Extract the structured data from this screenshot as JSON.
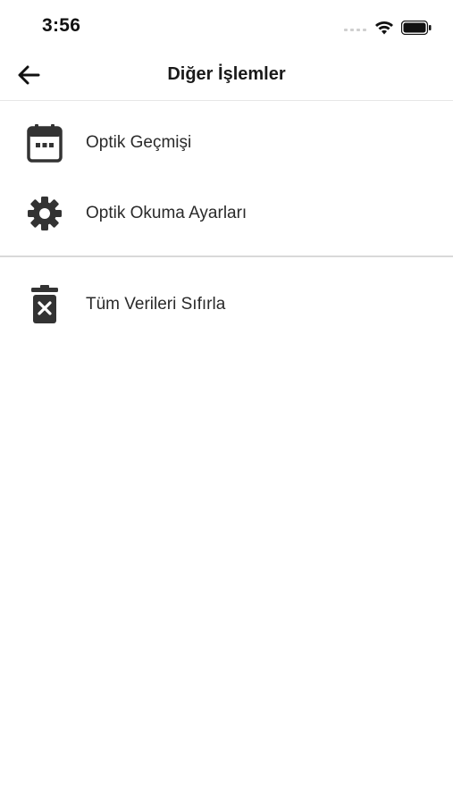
{
  "status_bar": {
    "time": "3:56"
  },
  "nav": {
    "title": "Diğer İşlemler",
    "back_icon": "arrow-left-icon"
  },
  "menu": {
    "items": [
      {
        "label": "Optik Geçmişi",
        "icon": "calendar-icon"
      },
      {
        "label": "Optik Okuma Ayarları",
        "icon": "gear-icon"
      },
      {
        "label": "Tüm Verileri Sıfırla",
        "icon": "trash-icon"
      }
    ]
  },
  "colors": {
    "icon": "#333333",
    "text": "#2a2a2a",
    "divider": "#d9d9d9"
  }
}
